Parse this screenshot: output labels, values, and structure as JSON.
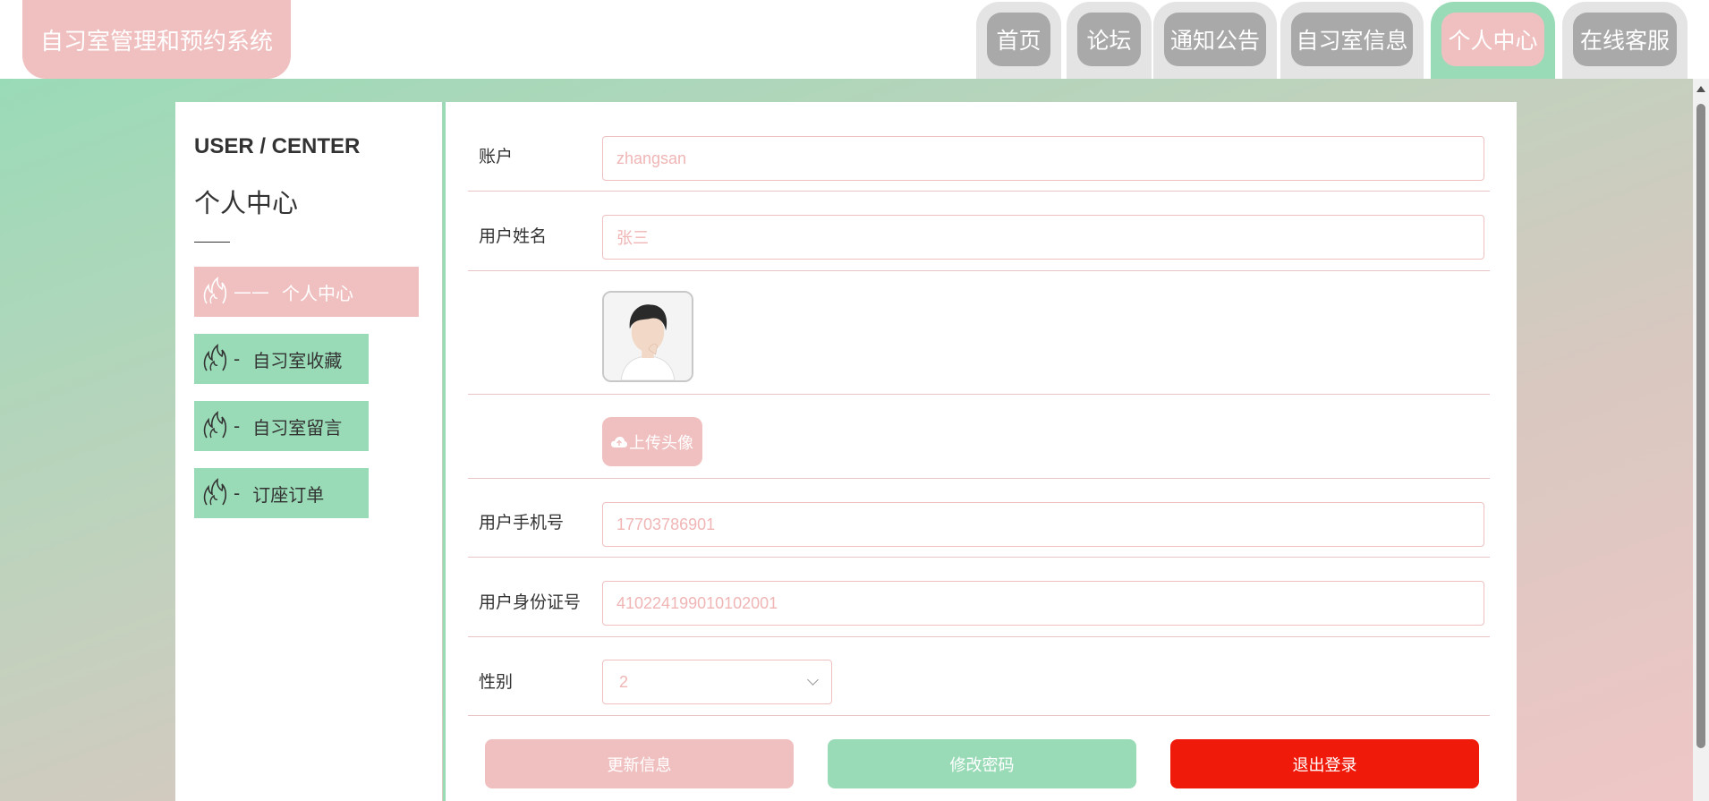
{
  "app": {
    "title": "自习室管理和预约系统"
  },
  "nav": {
    "tabs": [
      {
        "label": "首页"
      },
      {
        "label": "论坛"
      },
      {
        "label": "通知公告"
      },
      {
        "label": "自习室信息"
      },
      {
        "label": "个人中心",
        "active": true
      },
      {
        "label": "在线客服"
      }
    ]
  },
  "sidebar": {
    "title_en": "USER / CENTER",
    "title_cn": "个人中心",
    "items": [
      {
        "label": "个人中心",
        "dash": "——",
        "active": true
      },
      {
        "label": "自习室收藏",
        "dash": "-"
      },
      {
        "label": "自习室留言",
        "dash": "-"
      },
      {
        "label": "订座订单",
        "dash": "-"
      }
    ],
    "icon": "flame-icon"
  },
  "form": {
    "account_label": "账户",
    "account_value": "zhangsan",
    "name_label": "用户姓名",
    "name_value": "张三",
    "upload_label": "上传头像",
    "phone_label": "用户手机号",
    "phone_value": "17703786901",
    "idcard_label": "用户身份证号",
    "idcard_value": "410224199010102001",
    "gender_label": "性别",
    "gender_value": "2"
  },
  "actions": {
    "update_label": "更新信息",
    "password_label": "修改密码",
    "logout_label": "退出登录"
  },
  "colors": {
    "pink": "#f0c0c0",
    "green": "#9adbb7",
    "gray": "#a9a9a9",
    "red": "#f01a0a"
  }
}
